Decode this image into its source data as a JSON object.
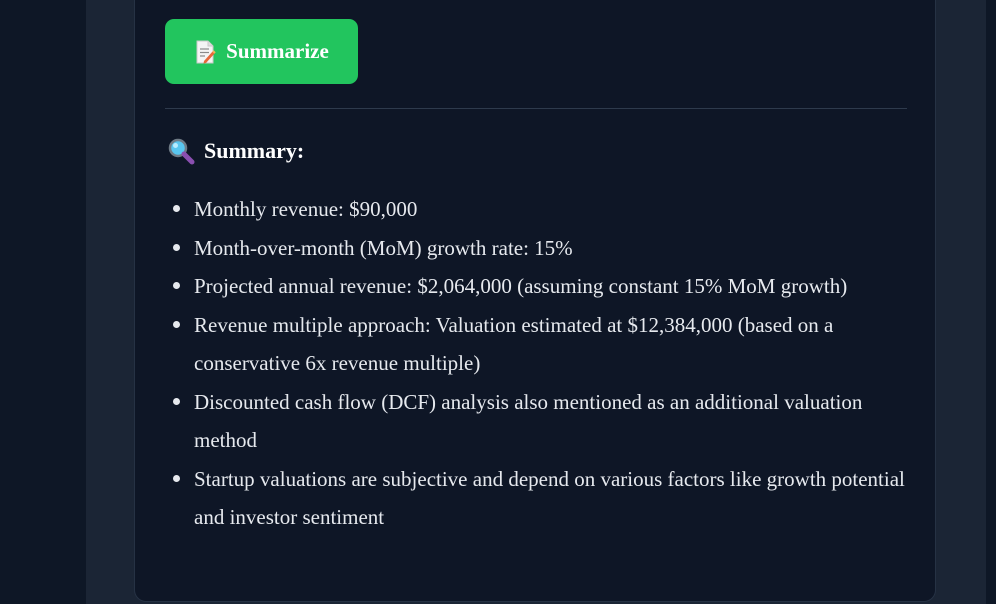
{
  "button": {
    "label": "Summarize",
    "icon": "memo-icon",
    "color": "#22c55e"
  },
  "summary": {
    "heading": "Summary:",
    "icon": "magnifier-icon",
    "points": [
      "Monthly revenue: $90,000",
      "Month-over-month (MoM) growth rate: 15%",
      "Projected annual revenue: $2,064,000 (assuming constant 15% MoM growth)",
      "Revenue multiple approach: Valuation estimated at $12,384,000 (based on a conservative 6x revenue multiple)",
      "Discounted cash flow (DCF) analysis also mentioned as an additional valuation method",
      "Startup valuations are subjective and depend on various factors like growth potential and investor sentiment"
    ]
  }
}
